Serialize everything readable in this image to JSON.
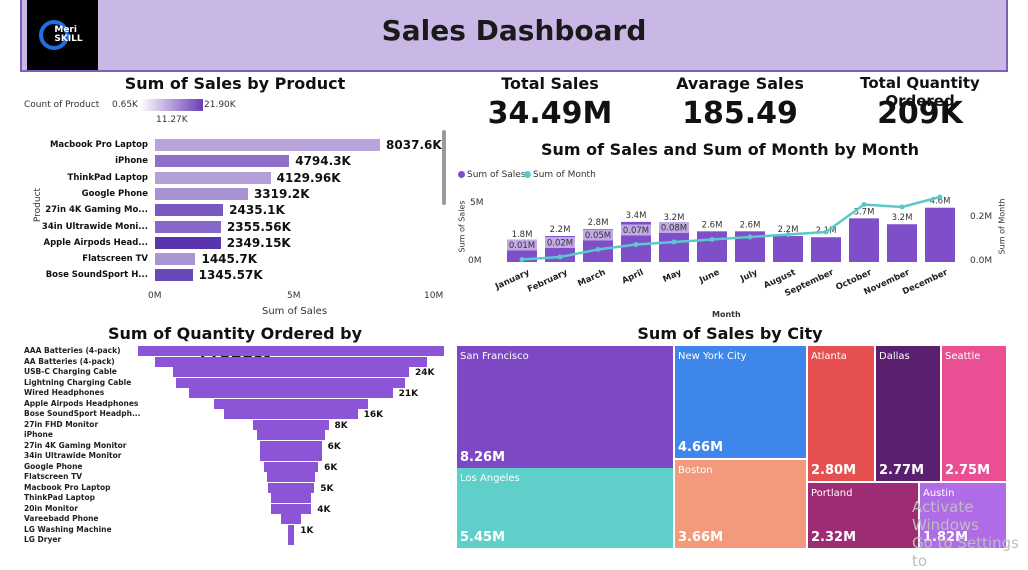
{
  "header": {
    "title": "Sales Dashboard",
    "logo_line1": "Meri",
    "logo_line2": "SKILL"
  },
  "kpis": {
    "total_sales_label": "Total Sales",
    "total_sales_value": "34.49M",
    "avg_sales_label": "Avarage Sales",
    "avg_sales_value": "185.49",
    "qty_label": "Total Quantity Ordered",
    "qty_value": "209K"
  },
  "product_sales": {
    "title": "Sum of Sales by Product",
    "legend_label": "Count of Product",
    "legend_min": "0.65K",
    "legend_max": "21.90K",
    "legend_mid": "11.27K",
    "ylabel": "Product",
    "xlabel": "Sum of Sales",
    "ticks": [
      "0M",
      "5M",
      "10M"
    ],
    "colors": [
      "#b9a4db",
      "#8f6fc9",
      "#b3a0d8",
      "#a791d3",
      "#7b58c0",
      "#8668c6",
      "#5a34ad",
      "#a994d4",
      "#6a48b7"
    ],
    "items": [
      {
        "name": "Macbook Pro Laptop",
        "value": 8037.6,
        "label": "8037.6K"
      },
      {
        "name": "iPhone",
        "value": 4794.3,
        "label": "4794.3K"
      },
      {
        "name": "ThinkPad Laptop",
        "value": 4129.96,
        "label": "4129.96K"
      },
      {
        "name": "Google Phone",
        "value": 3319.2,
        "label": "3319.2K"
      },
      {
        "name": "27in 4K Gaming Mo...",
        "value": 2435.1,
        "label": "2435.1K"
      },
      {
        "name": "34in Ultrawide Moni...",
        "value": 2355.56,
        "label": "2355.56K"
      },
      {
        "name": "Apple Airpods Head...",
        "value": 2349.15,
        "label": "2349.15K"
      },
      {
        "name": "Flatscreen TV",
        "value": 1445.7,
        "label": "1445.7K"
      },
      {
        "name": "Bose SoundSport H...",
        "value": 1345.57,
        "label": "1345.57K"
      }
    ]
  },
  "monthly": {
    "title": "Sum of Sales and Sum of Month by Month",
    "legend_sales": "Sum of Sales",
    "legend_month": "Sum of Month",
    "ylabel_left": "Sum of Sales",
    "ylabel_right": "Sum of Month",
    "xlabel": "Month",
    "left_ticks": [
      "5M",
      "0M"
    ],
    "right_ticks": [
      "0.2M",
      "0.0M"
    ],
    "bar_color": "#7e4fc9",
    "line_color": "#5bc9c9",
    "months": [
      "January",
      "February",
      "March",
      "April",
      "May",
      "June",
      "July",
      "August",
      "September",
      "October",
      "November",
      "December"
    ],
    "sales": [
      1.8,
      2.2,
      2.8,
      3.4,
      3.2,
      2.6,
      2.6,
      2.2,
      2.1,
      3.7,
      3.2,
      4.6
    ],
    "sales_labels": [
      "1.8M",
      "2.2M",
      "2.8M",
      "3.4M",
      "3.2M",
      "2.6M",
      "2.6M",
      "2.2M",
      "2.1M",
      "3.7M",
      "3.2M",
      "4.6M"
    ],
    "month_sum": [
      0.01,
      0.02,
      0.05,
      0.07,
      0.08,
      0.09,
      0.1,
      0.11,
      0.12,
      0.23,
      0.22,
      0.26
    ],
    "month_labels": [
      "0.01M",
      "0.02M",
      "0.05M",
      "0.07M",
      "0.08M",
      "",
      "",
      "",
      "",
      "",
      "",
      ""
    ]
  },
  "quantity": {
    "title": "Sum of Quantity Ordered by Product",
    "color": "#8c55d8",
    "items": [
      {
        "name": "AAA Batteries (4-pack)",
        "value": 31,
        "label": ""
      },
      {
        "name": "AA Batteries (4-pack)",
        "value": 27.6,
        "label": ""
      },
      {
        "name": "USB-C Charging Cable",
        "value": 23.9,
        "label": "24K"
      },
      {
        "name": "Lightning Charging Cable",
        "value": 23.2,
        "label": ""
      },
      {
        "name": "Wired Headphones",
        "value": 20.6,
        "label": "21K"
      },
      {
        "name": "Apple Airpods Headphones",
        "value": 15.6,
        "label": ""
      },
      {
        "name": "Bose SoundSport Headph...",
        "value": 13.5,
        "label": "16K"
      },
      {
        "name": "27in FHD Monitor",
        "value": 7.6,
        "label": "8K"
      },
      {
        "name": "iPhone",
        "value": 6.8,
        "label": ""
      },
      {
        "name": "27in 4K Gaming Monitor",
        "value": 6.2,
        "label": "6K"
      },
      {
        "name": "34in Ultrawide Monitor",
        "value": 6.2,
        "label": ""
      },
      {
        "name": "Google Phone",
        "value": 5.5,
        "label": "6K"
      },
      {
        "name": "Flatscreen TV",
        "value": 4.8,
        "label": ""
      },
      {
        "name": "Macbook Pro Laptop",
        "value": 4.7,
        "label": "5K"
      },
      {
        "name": "ThinkPad Laptop",
        "value": 4.1,
        "label": ""
      },
      {
        "name": "20in Monitor",
        "value": 4.1,
        "label": "4K"
      },
      {
        "name": "Vareebadd Phone",
        "value": 2.1,
        "label": ""
      },
      {
        "name": "LG Washing Machine",
        "value": 0.67,
        "label": "1K"
      },
      {
        "name": "LG Dryer",
        "value": 0.65,
        "label": ""
      }
    ]
  },
  "city": {
    "title": "Sum of Sales by City",
    "tiles": [
      {
        "name": "San Francisco",
        "label": "8.26M",
        "color": "#7d48c4"
      },
      {
        "name": "Los Angeles",
        "label": "5.45M",
        "color": "#5ecfc9"
      },
      {
        "name": "New York City",
        "label": "4.66M",
        "color": "#3e86ea"
      },
      {
        "name": "Boston",
        "label": "3.66M",
        "color": "#f39a7d"
      },
      {
        "name": "Atlanta",
        "label": "2.80M",
        "color": "#e75050"
      },
      {
        "name": "Dallas",
        "label": "2.77M",
        "color": "#5a1f6e"
      },
      {
        "name": "Seattle",
        "label": "2.75M",
        "color": "#ea4f93"
      },
      {
        "name": "Portland",
        "label": "2.32M",
        "color": "#9d2c74"
      },
      {
        "name": "Austin",
        "label": "1.82M",
        "color": "#b06be6"
      }
    ]
  },
  "watermark": {
    "line1": "Activate Windows",
    "line2": "Go to Settings to"
  }
}
